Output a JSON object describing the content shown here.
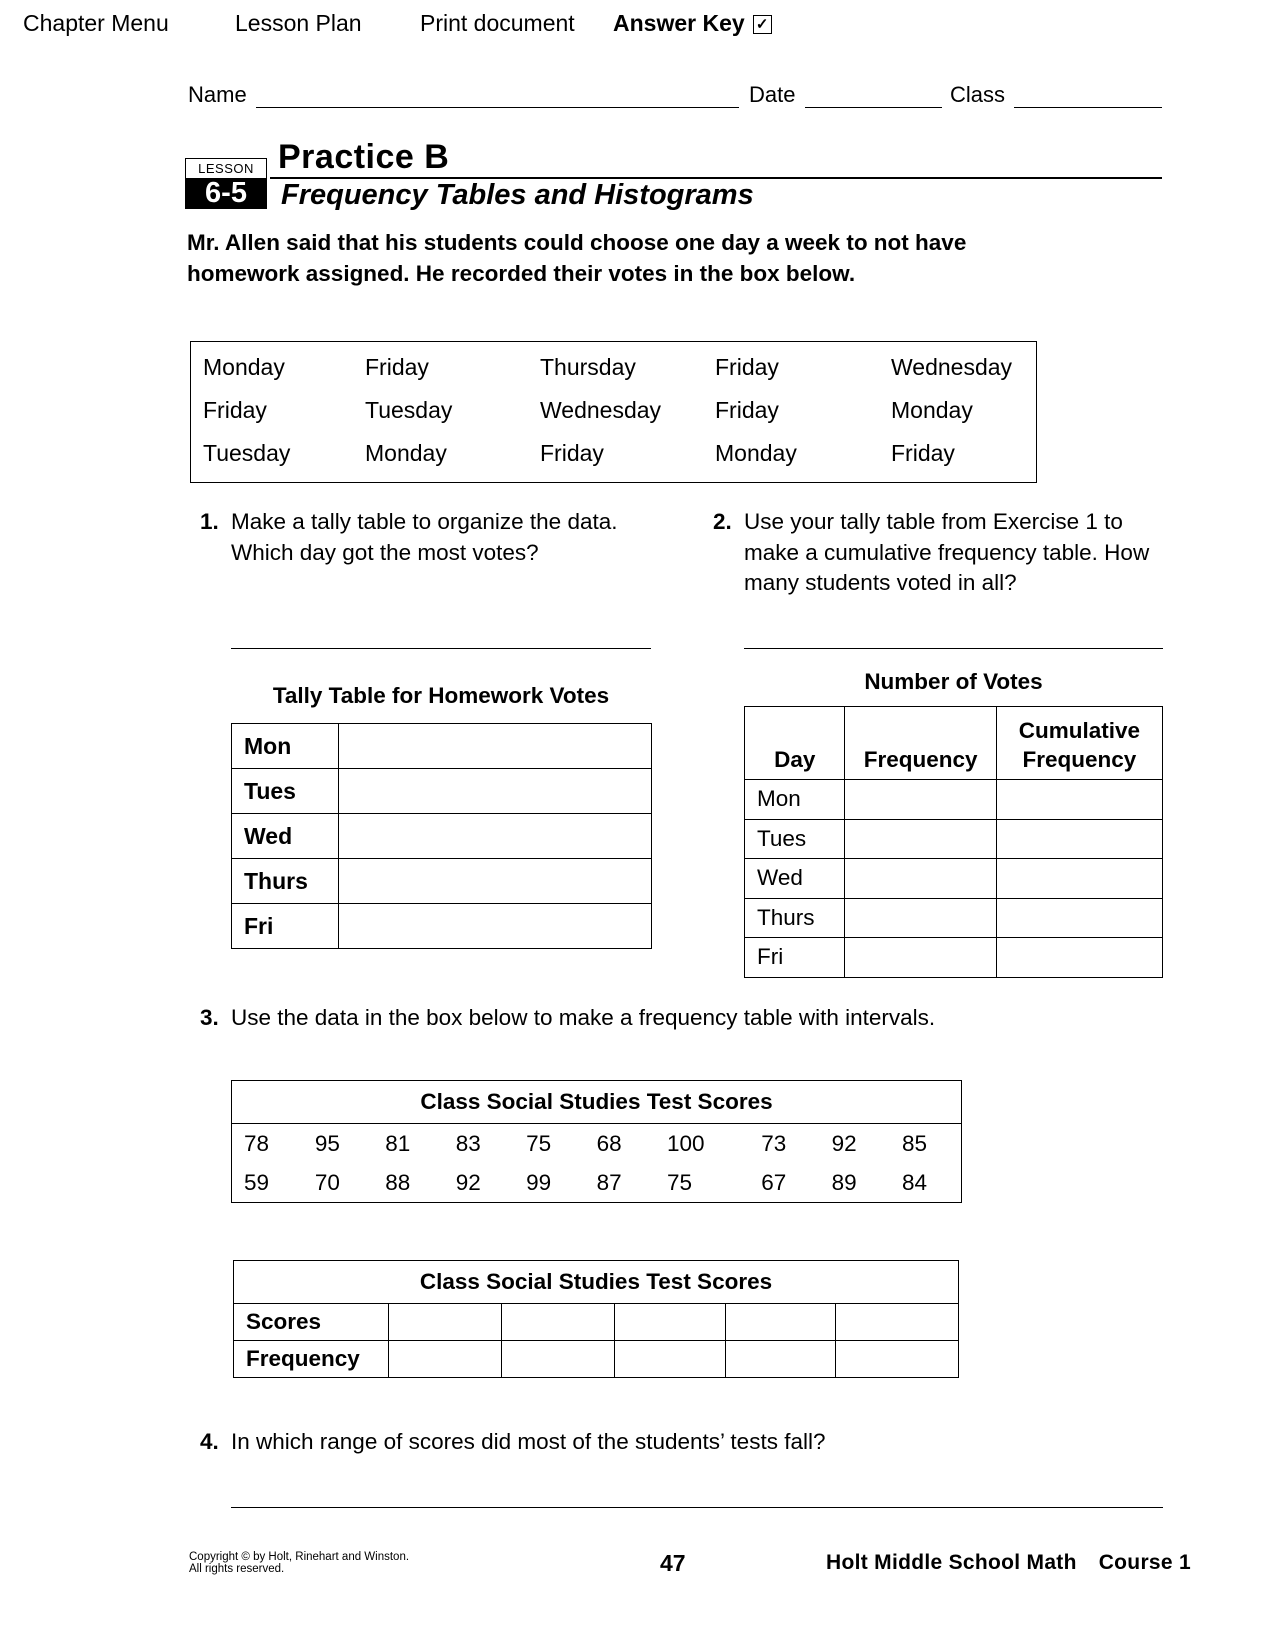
{
  "nav": {
    "chapter_menu": "Chapter Menu",
    "lesson_plan": "Lesson Plan",
    "print_document": "Print document",
    "answer_key": "Answer Key",
    "answer_key_icon": "checkbox-check-icon",
    "answer_key_glyph": "✓"
  },
  "header": {
    "name_label": "Name",
    "date_label": "Date",
    "class_label": "Class"
  },
  "lesson": {
    "badge_label": "LESSON",
    "number": "6-5",
    "title": "Practice B",
    "subtitle": "Frequency Tables and Histograms"
  },
  "intro": "Mr. Allen said that his students could choose one day a week to not have homework assigned. He recorded their votes in the box below.",
  "votes": {
    "rows": [
      [
        "Monday",
        "Friday",
        "Thursday",
        "Friday",
        "Wednesday"
      ],
      [
        "Friday",
        "Tuesday",
        "Wednesday",
        "Friday",
        "Monday"
      ],
      [
        "Tuesday",
        "Monday",
        "Friday",
        "Monday",
        "Friday"
      ]
    ]
  },
  "questions": [
    {
      "number": "1.",
      "text": "Make a tally table to organize the data. Which day got the most votes?"
    },
    {
      "number": "2.",
      "text": "Use your tally table from Exercise 1 to make a cumulative frequency table. How many students voted in all?"
    },
    {
      "number": "3.",
      "text": "Use the data in the box below to make a frequency table with intervals."
    },
    {
      "number": "4.",
      "text": "In which range of scores did most of the students’ tests fall?"
    }
  ],
  "tally_table": {
    "caption": "Tally Table for Homework Votes",
    "rows": [
      "Mon",
      "Tues",
      "Wed",
      "Thurs",
      "Fri"
    ]
  },
  "cumulative_table": {
    "caption": "Number of Votes",
    "headers": [
      "Day",
      "Frequency",
      "Cumulative Frequency"
    ],
    "rows": [
      "Mon",
      "Tues",
      "Wed",
      "Thurs",
      "Fri"
    ]
  },
  "scores_table": {
    "caption": "Class Social Studies Test Scores",
    "rows": [
      [
        "78",
        "95",
        "81",
        "83",
        "75",
        "68",
        "100",
        "73",
        "92",
        "85"
      ],
      [
        "59",
        "70",
        "88",
        "92",
        "99",
        "87",
        "75",
        "67",
        "89",
        "84"
      ]
    ]
  },
  "interval_table": {
    "caption": "Class Social Studies Test Scores",
    "row_labels": [
      "Scores",
      "Frequency"
    ]
  },
  "footer": {
    "copyright_line1": "Copyright © by Holt, Rinehart and Winston.",
    "copyright_line2": "All rights reserved.",
    "page_number": "47",
    "book": "Holt Middle School Math",
    "course": "Course 1"
  }
}
